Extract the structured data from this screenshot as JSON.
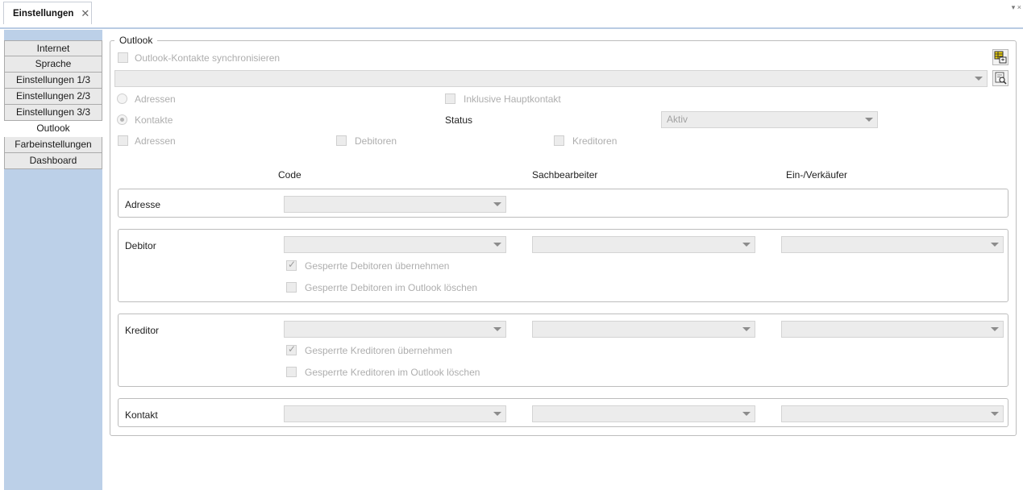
{
  "tab": {
    "title": "Einstellungen",
    "close": "✕"
  },
  "strip_menu": "▾ ×",
  "sidebar": {
    "items": [
      {
        "label": "Internet"
      },
      {
        "label": "Sprache"
      },
      {
        "label": "Einstellungen 1/3"
      },
      {
        "label": "Einstellungen 2/3"
      },
      {
        "label": "Einstellungen 3/3"
      },
      {
        "label": "Outlook"
      },
      {
        "label": "Farbeinstellungen"
      },
      {
        "label": "Dashboard"
      }
    ],
    "active": "Outlook"
  },
  "outlook": {
    "legend": "Outlook",
    "sync_label": "Outlook-Kontakte synchronisieren",
    "sync_checked": false,
    "profile_value": "",
    "radio_adressen": "Adressen",
    "radio_kontakte": "Kontakte",
    "radio_selected": "Kontakte",
    "inkl_hauptkontakt": "Inklusive Hauptkontakt",
    "status_label": "Status",
    "status_value": "Aktiv",
    "chk_adressen": "Adressen",
    "chk_debitoren": "Debitoren",
    "chk_kreditoren": "Kreditoren",
    "columns": {
      "code": "Code",
      "sachbearbeiter": "Sachbearbeiter",
      "verkaeufer": "Ein-/Verkäufer"
    },
    "adresse": {
      "label": "Adresse"
    },
    "debitor": {
      "label": "Debitor",
      "chk1": "Gesperrte Debitoren übernehmen",
      "chk1_checked": true,
      "chk2": "Gesperrte Debitoren im Outlook löschen",
      "chk2_checked": false
    },
    "kreditor": {
      "label": "Kreditor",
      "chk1": "Gesperrte Kreditoren übernehmen",
      "chk1_checked": true,
      "chk2": "Gesperrte Kreditoren im Outlook löschen",
      "chk2_checked": false
    },
    "kontakt": {
      "label": "Kontakt"
    }
  },
  "icons": {
    "sync_settings": "table-sync-icon",
    "browse": "browse-search-icon"
  }
}
